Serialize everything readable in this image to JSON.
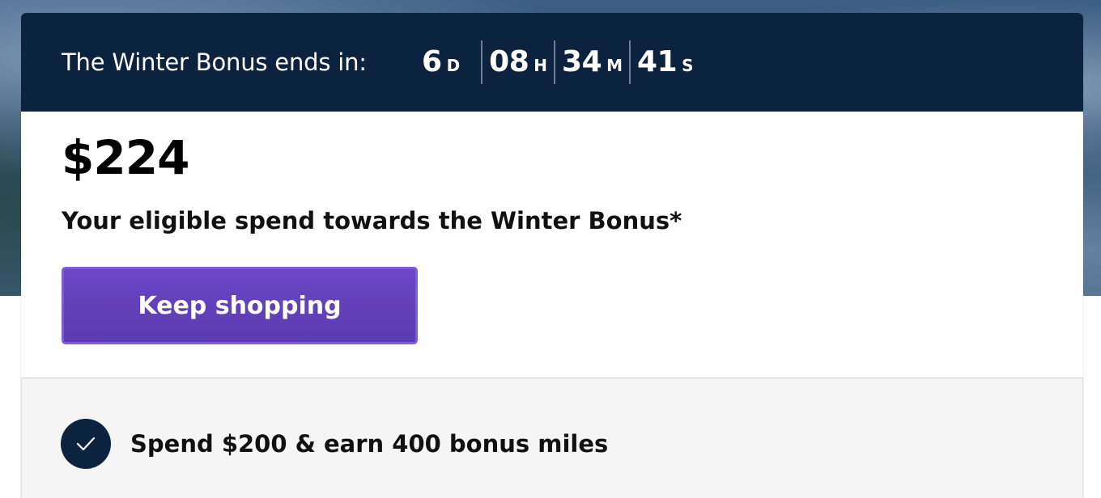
{
  "countdown": {
    "label": "The Winter Bonus ends in:",
    "units": [
      {
        "value": "6",
        "unit": "D"
      },
      {
        "value": "08",
        "unit": "H"
      },
      {
        "value": "34",
        "unit": "M"
      },
      {
        "value": "41",
        "unit": "S"
      }
    ]
  },
  "summary": {
    "amount": "$224",
    "description": "Your eligible spend towards the Winter Bonus*",
    "cta_label": "Keep shopping"
  },
  "milestones": [
    {
      "text": "Spend $200 & earn 400 bonus miles",
      "completed": true,
      "icon": "check-icon"
    }
  ],
  "colors": {
    "header_bg": "#0c2340",
    "button_bg": "#5b3bb0",
    "check_bg": "#0c2340",
    "section_bg": "#f5f5f5"
  }
}
